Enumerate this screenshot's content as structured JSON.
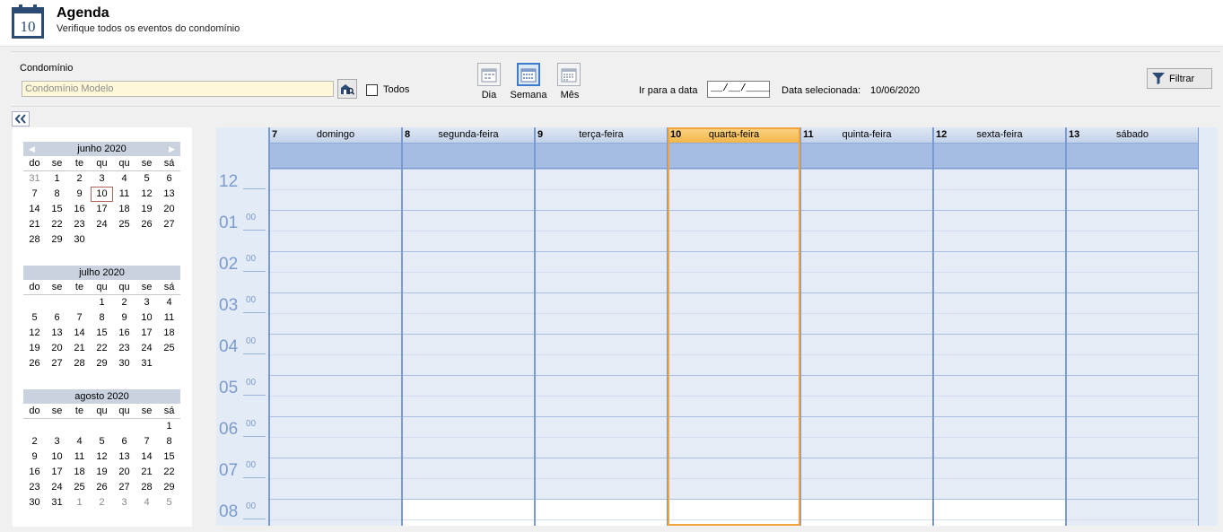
{
  "header": {
    "icon_day": "10",
    "title": "Agenda",
    "subtitle": "Verifique todos os eventos do condomínio"
  },
  "toolbar": {
    "condominio_label": "Condomínio",
    "condominio_value": "Condomínio Modelo",
    "todos_label": "Todos",
    "views": [
      {
        "label": "Dia",
        "icon": "day-view-icon"
      },
      {
        "label": "Semana",
        "icon": "week-view-icon",
        "active": true
      },
      {
        "label": "Mês",
        "icon": "month-view-icon"
      }
    ],
    "goto_label": "Ir para a data",
    "goto_value": "__/__/____",
    "selected_label": "Data selecionada:",
    "selected_value": "10/06/2020",
    "filter_label": "Filtrar"
  },
  "minicals": [
    {
      "month": "junho 2020",
      "dows": [
        "do",
        "se",
        "te",
        "qu",
        "qu",
        "se",
        "sá"
      ],
      "days": [
        "31",
        "1",
        "2",
        "3",
        "4",
        "5",
        "6",
        "7",
        "8",
        "9",
        "10",
        "11",
        "12",
        "13",
        "14",
        "15",
        "16",
        "17",
        "18",
        "19",
        "20",
        "21",
        "22",
        "23",
        "24",
        "25",
        "26",
        "27",
        "28",
        "29",
        "30",
        "",
        "",
        "",
        "",
        ""
      ],
      "other": [
        0
      ],
      "today": 10
    },
    {
      "month": "julho 2020",
      "dows": [
        "do",
        "se",
        "te",
        "qu",
        "qu",
        "se",
        "sá"
      ],
      "days": [
        "",
        "",
        "",
        "1",
        "2",
        "3",
        "4",
        "5",
        "6",
        "7",
        "8",
        "9",
        "10",
        "11",
        "12",
        "13",
        "14",
        "15",
        "16",
        "17",
        "18",
        "19",
        "20",
        "21",
        "22",
        "23",
        "24",
        "25",
        "26",
        "27",
        "28",
        "29",
        "30",
        "31",
        ""
      ],
      "other": [],
      "today": -1
    },
    {
      "month": "agosto 2020",
      "dows": [
        "do",
        "se",
        "te",
        "qu",
        "qu",
        "se",
        "sá"
      ],
      "days": [
        "",
        "",
        "",
        "",
        "",
        "",
        "1",
        "2",
        "3",
        "4",
        "5",
        "6",
        "7",
        "8",
        "9",
        "10",
        "11",
        "12",
        "13",
        "14",
        "15",
        "16",
        "17",
        "18",
        "19",
        "20",
        "21",
        "22",
        "23",
        "24",
        "25",
        "26",
        "27",
        "28",
        "29",
        "30",
        "31",
        "1",
        "2",
        "3",
        "4",
        "5"
      ],
      "other": [
        37,
        38,
        39,
        40,
        41
      ],
      "today": -1
    }
  ],
  "week": [
    {
      "num": "7",
      "name": "domingo"
    },
    {
      "num": "8",
      "name": "segunda-feira"
    },
    {
      "num": "9",
      "name": "terça-feira"
    },
    {
      "num": "10",
      "name": "quarta-feira"
    },
    {
      "num": "11",
      "name": "quinta-feira"
    },
    {
      "num": "12",
      "name": "sexta-feira"
    },
    {
      "num": "13",
      "name": "sábado"
    }
  ],
  "hours": [
    {
      "h": "12",
      "m": ""
    },
    {
      "h": "01",
      "m": "00"
    },
    {
      "h": "02",
      "m": "00"
    },
    {
      "h": "03",
      "m": "00"
    },
    {
      "h": "04",
      "m": "00"
    },
    {
      "h": "05",
      "m": "00"
    },
    {
      "h": "06",
      "m": "00"
    },
    {
      "h": "07",
      "m": "00"
    },
    {
      "h": "08",
      "m": "00"
    }
  ],
  "colors": {
    "accent": "#3d7bcf",
    "today": "#f2a33d",
    "allday": "#a5bde2"
  }
}
